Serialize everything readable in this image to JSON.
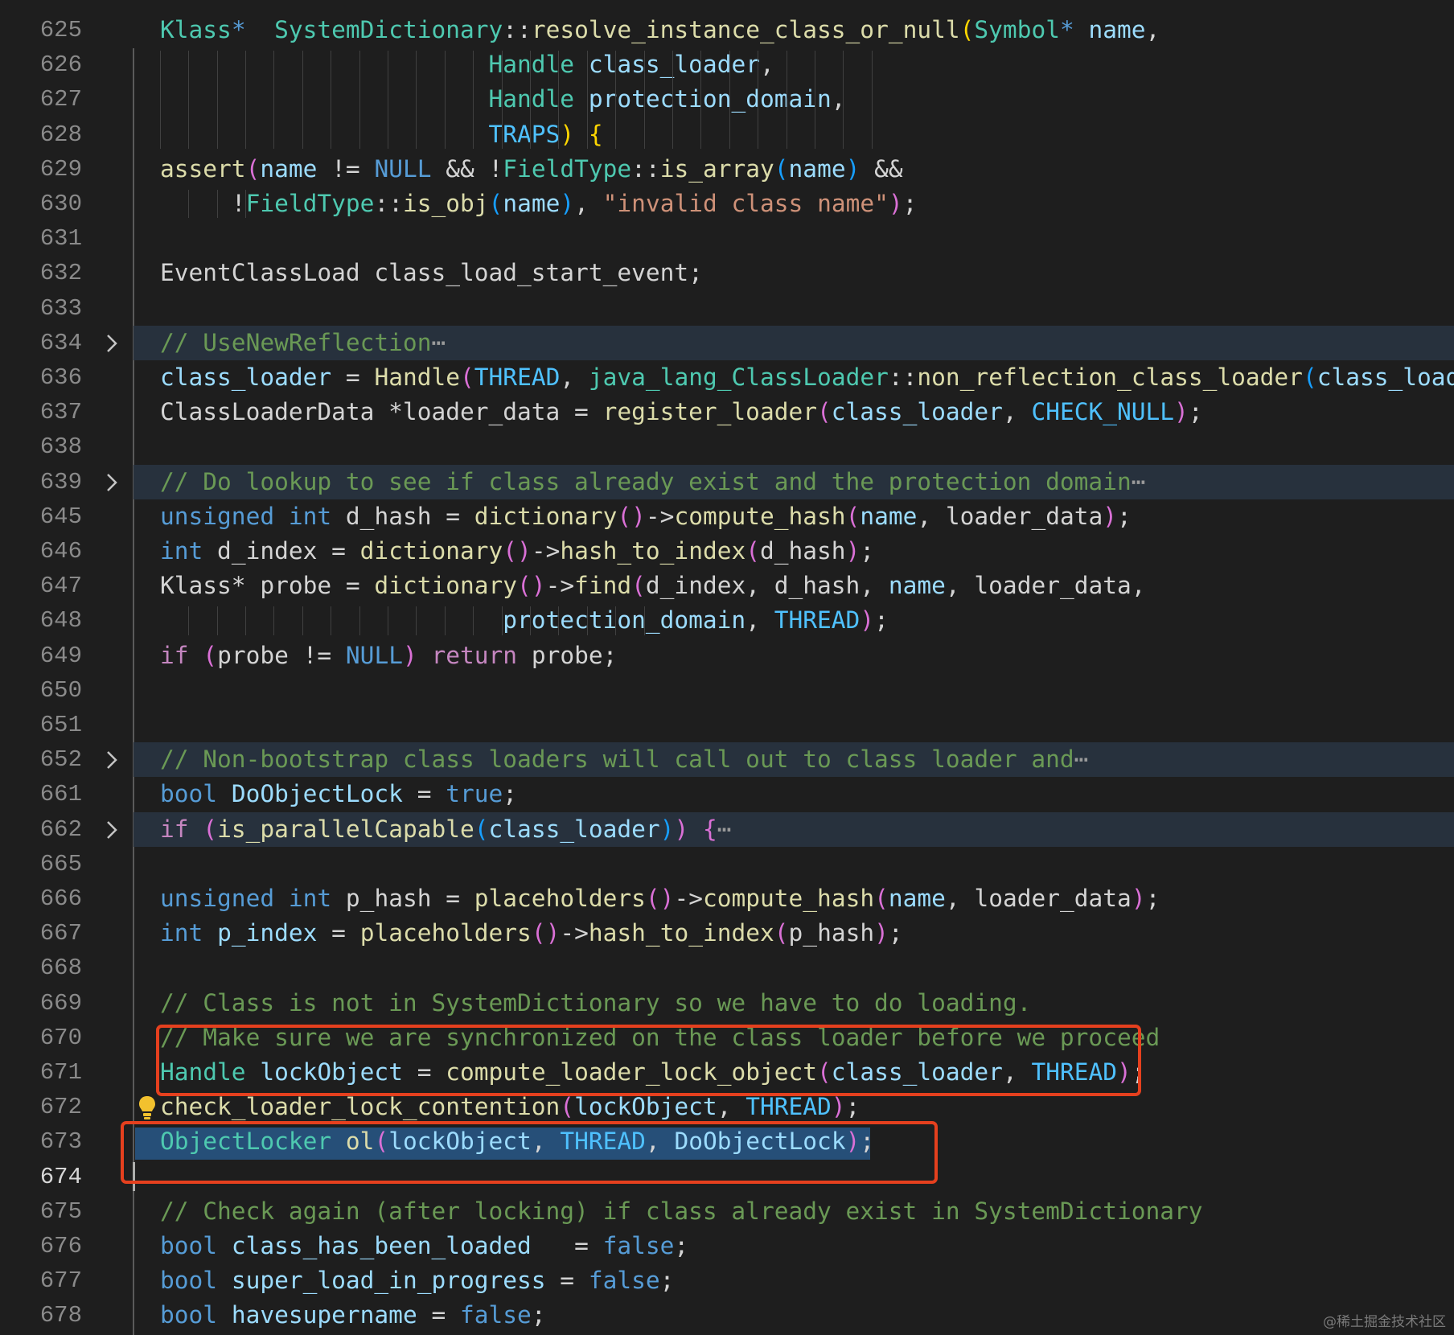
{
  "editor": {
    "lines": [
      {
        "num": "625",
        "tokens": [
          [
            "t",
            "Klass"
          ],
          [
            "k",
            "*"
          ],
          [
            "",
            "  "
          ],
          [
            "t",
            "SystemDictionary"
          ],
          [
            "",
            "::"
          ],
          [
            "f",
            "resolve_instance_class_or_null"
          ],
          [
            "p1",
            "("
          ],
          [
            "t",
            "Symbol"
          ],
          [
            "k",
            "*"
          ],
          [
            "",
            " "
          ],
          [
            "v",
            "name"
          ],
          [
            "",
            ","
          ]
        ]
      },
      {
        "num": "626",
        "tokens": [
          [
            "",
            "                       "
          ],
          [
            "t",
            "Handle"
          ],
          [
            "",
            " "
          ],
          [
            "v",
            "class_loader"
          ],
          [
            "",
            ","
          ]
        ]
      },
      {
        "num": "627",
        "tokens": [
          [
            "",
            "                       "
          ],
          [
            "t",
            "Handle"
          ],
          [
            "",
            " "
          ],
          [
            "v",
            "protection_domain"
          ],
          [
            "",
            ","
          ]
        ]
      },
      {
        "num": "628",
        "tokens": [
          [
            "",
            "                       "
          ],
          [
            "m",
            "TRAPS"
          ],
          [
            "p1",
            ")"
          ],
          [
            "",
            " "
          ],
          [
            "p1",
            "{"
          ]
        ]
      },
      {
        "num": "629",
        "tokens": [
          [
            "f",
            "assert"
          ],
          [
            "p2",
            "("
          ],
          [
            "v",
            "name"
          ],
          [
            "",
            " != "
          ],
          [
            "k",
            "NULL"
          ],
          [
            "",
            " && !"
          ],
          [
            "t",
            "FieldType"
          ],
          [
            "",
            "::"
          ],
          [
            "f",
            "is_array"
          ],
          [
            "p3",
            "("
          ],
          [
            "v",
            "name"
          ],
          [
            "p3",
            ")"
          ],
          [
            "",
            " &&"
          ]
        ]
      },
      {
        "num": "630",
        "tokens": [
          [
            "",
            "     !"
          ],
          [
            "t",
            "FieldType"
          ],
          [
            "",
            "::"
          ],
          [
            "f",
            "is_obj"
          ],
          [
            "p3",
            "("
          ],
          [
            "v",
            "name"
          ],
          [
            "p3",
            ")"
          ],
          [
            "",
            ", "
          ],
          [
            "s",
            "\"invalid class name\""
          ],
          [
            "p2",
            ")"
          ],
          [
            "",
            ";"
          ]
        ]
      },
      {
        "num": "631",
        "tokens": []
      },
      {
        "num": "632",
        "tokens": [
          [
            "",
            "EventClassLoad class_load_start_event;"
          ]
        ]
      },
      {
        "num": "633",
        "tokens": []
      },
      {
        "num": "634",
        "fold": true,
        "tokens": [
          [
            "c",
            "// UseNewReflection"
          ],
          [
            "ell",
            "⋯"
          ]
        ]
      },
      {
        "num": "636",
        "tokens": [
          [
            "v",
            "class_loader"
          ],
          [
            "",
            " = "
          ],
          [
            "f",
            "Handle"
          ],
          [
            "p2",
            "("
          ],
          [
            "m",
            "THREAD"
          ],
          [
            "",
            ", "
          ],
          [
            "t",
            "java_lang_ClassLoader"
          ],
          [
            "",
            "::"
          ],
          [
            "f",
            "non_reflection_class_loader"
          ],
          [
            "p3",
            "("
          ],
          [
            "v",
            "class_loader"
          ]
        ]
      },
      {
        "num": "637",
        "tokens": [
          [
            "",
            "ClassLoaderData *loader_data = "
          ],
          [
            "f",
            "register_loader"
          ],
          [
            "p2",
            "("
          ],
          [
            "v",
            "class_loader"
          ],
          [
            "",
            ", "
          ],
          [
            "m",
            "CHECK_NULL"
          ],
          [
            "p2",
            ")"
          ],
          [
            "",
            ";"
          ]
        ]
      },
      {
        "num": "638",
        "tokens": []
      },
      {
        "num": "639",
        "fold": true,
        "tokens": [
          [
            "c",
            "// Do lookup to see if class already exist and the protection domain"
          ],
          [
            "ell",
            "⋯"
          ]
        ]
      },
      {
        "num": "645",
        "tokens": [
          [
            "k",
            "unsigned"
          ],
          [
            "",
            " "
          ],
          [
            "k",
            "int"
          ],
          [
            "",
            " d_hash = "
          ],
          [
            "f",
            "dictionary"
          ],
          [
            "p2",
            "()"
          ],
          [
            "",
            "->"
          ],
          [
            "f",
            "compute_hash"
          ],
          [
            "p2",
            "("
          ],
          [
            "v",
            "name"
          ],
          [
            "",
            ", loader_data"
          ],
          [
            "p2",
            ")"
          ],
          [
            "",
            ";"
          ]
        ]
      },
      {
        "num": "646",
        "tokens": [
          [
            "k",
            "int"
          ],
          [
            "",
            " d_index = "
          ],
          [
            "f",
            "dictionary"
          ],
          [
            "p2",
            "()"
          ],
          [
            "",
            "->"
          ],
          [
            "f",
            "hash_to_index"
          ],
          [
            "p2",
            "("
          ],
          [
            "",
            "d_hash"
          ],
          [
            "p2",
            ")"
          ],
          [
            "",
            ";"
          ]
        ]
      },
      {
        "num": "647",
        "tokens": [
          [
            "",
            "Klass* probe = "
          ],
          [
            "f",
            "dictionary"
          ],
          [
            "p2",
            "()"
          ],
          [
            "",
            "->"
          ],
          [
            "f",
            "find"
          ],
          [
            "p2",
            "("
          ],
          [
            "",
            "d_index, d_hash, "
          ],
          [
            "v",
            "name"
          ],
          [
            "",
            ", loader_data,"
          ]
        ]
      },
      {
        "num": "648",
        "tokens": [
          [
            "",
            "                        "
          ],
          [
            "v",
            "protection_domain"
          ],
          [
            "",
            ", "
          ],
          [
            "m",
            "THREAD"
          ],
          [
            "p2",
            ")"
          ],
          [
            "",
            ";"
          ]
        ]
      },
      {
        "num": "649",
        "tokens": [
          [
            "ctl",
            "if"
          ],
          [
            "",
            " "
          ],
          [
            "p2",
            "("
          ],
          [
            "",
            "probe != "
          ],
          [
            "k",
            "NULL"
          ],
          [
            "p2",
            ")"
          ],
          [
            "",
            " "
          ],
          [
            "ctl",
            "return"
          ],
          [
            "",
            " probe;"
          ]
        ]
      },
      {
        "num": "650",
        "tokens": []
      },
      {
        "num": "651",
        "tokens": []
      },
      {
        "num": "652",
        "fold": true,
        "tokens": [
          [
            "c",
            "// Non-bootstrap class loaders will call out to class loader and"
          ],
          [
            "ell",
            "⋯"
          ]
        ]
      },
      {
        "num": "661",
        "tokens": [
          [
            "k",
            "bool"
          ],
          [
            "",
            " "
          ],
          [
            "v",
            "DoObjectLock"
          ],
          [
            "",
            " = "
          ],
          [
            "k",
            "true"
          ],
          [
            "",
            ";"
          ]
        ]
      },
      {
        "num": "662",
        "fold": true,
        "tokens": [
          [
            "ctl",
            "if"
          ],
          [
            "",
            " "
          ],
          [
            "p2",
            "("
          ],
          [
            "f",
            "is_parallelCapable"
          ],
          [
            "p3",
            "("
          ],
          [
            "v",
            "class_loader"
          ],
          [
            "p3",
            ")"
          ],
          [
            "p2",
            ")"
          ],
          [
            "",
            " "
          ],
          [
            "p2",
            "{"
          ],
          [
            "ell",
            "⋯"
          ]
        ]
      },
      {
        "num": "665",
        "tokens": []
      },
      {
        "num": "666",
        "tokens": [
          [
            "k",
            "unsigned"
          ],
          [
            "",
            " "
          ],
          [
            "k",
            "int"
          ],
          [
            "",
            " p_hash = "
          ],
          [
            "f",
            "placeholders"
          ],
          [
            "p2",
            "()"
          ],
          [
            "",
            "->"
          ],
          [
            "f",
            "compute_hash"
          ],
          [
            "p2",
            "("
          ],
          [
            "v",
            "name"
          ],
          [
            "",
            ", loader_data"
          ],
          [
            "p2",
            ")"
          ],
          [
            "",
            ";"
          ]
        ]
      },
      {
        "num": "667",
        "tokens": [
          [
            "k",
            "int"
          ],
          [
            "",
            " "
          ],
          [
            "v",
            "p_index"
          ],
          [
            "",
            " = "
          ],
          [
            "f",
            "placeholders"
          ],
          [
            "p2",
            "()"
          ],
          [
            "",
            "->"
          ],
          [
            "f",
            "hash_to_index"
          ],
          [
            "p2",
            "("
          ],
          [
            "",
            "p_hash"
          ],
          [
            "p2",
            ")"
          ],
          [
            "",
            ";"
          ]
        ]
      },
      {
        "num": "668",
        "tokens": []
      },
      {
        "num": "669",
        "tokens": [
          [
            "c",
            "// Class is not in SystemDictionary so we have to do loading."
          ]
        ]
      },
      {
        "num": "670",
        "tokens": [
          [
            "c",
            "// Make sure we are synchronized on the class loader before we proceed"
          ]
        ]
      },
      {
        "num": "671",
        "tokens": [
          [
            "t",
            "Handle"
          ],
          [
            "",
            " "
          ],
          [
            "v",
            "lockObject"
          ],
          [
            "",
            " = "
          ],
          [
            "f",
            "compute_loader_lock_object"
          ],
          [
            "p2",
            "("
          ],
          [
            "v",
            "class_loader"
          ],
          [
            "",
            ", "
          ],
          [
            "m",
            "THREAD"
          ],
          [
            "p2",
            ")"
          ],
          [
            "",
            ";"
          ]
        ]
      },
      {
        "num": "672",
        "tokens": [
          [
            "f",
            "check_loader_lock_contention"
          ],
          [
            "p2",
            "("
          ],
          [
            "v",
            "lockObject"
          ],
          [
            "",
            ", "
          ],
          [
            "m",
            "THREAD"
          ],
          [
            "p2",
            ")"
          ],
          [
            "",
            ";"
          ]
        ]
      },
      {
        "num": "673",
        "tokens": [
          [
            "t",
            "ObjectLocker"
          ],
          [
            "",
            " "
          ],
          [
            "f",
            "ol"
          ],
          [
            "p2",
            "("
          ],
          [
            "v",
            "lockObject"
          ],
          [
            "",
            ", "
          ],
          [
            "m",
            "THREAD"
          ],
          [
            "",
            ", "
          ],
          [
            "v",
            "DoObjectLock"
          ],
          [
            "p2",
            ")"
          ],
          [
            "",
            ";"
          ]
        ]
      },
      {
        "num": "674",
        "current": true,
        "tokens": []
      },
      {
        "num": "675",
        "tokens": [
          [
            "c",
            "// Check again (after locking) if class already exist in SystemDictionary"
          ]
        ]
      },
      {
        "num": "676",
        "tokens": [
          [
            "k",
            "bool"
          ],
          [
            "",
            " "
          ],
          [
            "v",
            "class_has_been_loaded"
          ],
          [
            "",
            "   = "
          ],
          [
            "k",
            "false"
          ],
          [
            "",
            ";"
          ]
        ]
      },
      {
        "num": "677",
        "tokens": [
          [
            "k",
            "bool"
          ],
          [
            "",
            " "
          ],
          [
            "v",
            "super_load_in_progress"
          ],
          [
            "",
            " = "
          ],
          [
            "k",
            "false"
          ],
          [
            "",
            ";"
          ]
        ]
      },
      {
        "num": "678",
        "tokens": [
          [
            "k",
            "bool"
          ],
          [
            "",
            " "
          ],
          [
            "v",
            "havesupername"
          ],
          [
            "",
            " = "
          ],
          [
            "k",
            "false"
          ],
          [
            "",
            ";"
          ]
        ]
      }
    ]
  },
  "colors": {
    "background": "#1e1e1e",
    "highlight_box": "#e5401e",
    "selection": "#264f78",
    "folded_line": "#27313d"
  },
  "icons": {
    "fold": "chevron-right-icon",
    "lightbulb": "lightbulb-icon"
  },
  "watermark": "@稀土掘金技术社区"
}
